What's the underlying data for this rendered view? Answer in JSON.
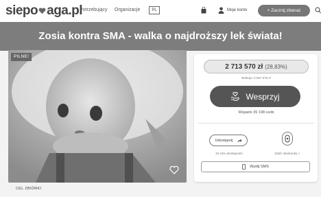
{
  "header": {
    "logo_left": "siepo",
    "logo_right": "aga.pl",
    "nav": [
      "Potrzebujący",
      "Organizacje"
    ],
    "language_flag": "PL",
    "account_label": "Moje konto",
    "start_button": "+ Zacznij zbierać",
    "icons": [
      "heart-icon",
      "bag-icon",
      "user-icon",
      "search-icon"
    ]
  },
  "banner": {
    "title": "Zosia kontra SMA - walka o najdroższy lek świata!"
  },
  "photo": {
    "urgent_badge": "PILNE!",
    "goal_label": "CEL ZBIÓRKI"
  },
  "panel": {
    "amount": "2 713 570 zł",
    "percent": "(28,83%)",
    "progress_fraction": 0.2883,
    "missing": "Brakuje: 6 697 678 zł",
    "support_button": "Wesprzyj",
    "supporters": "Wsparło 39 198 osób",
    "share_button": "Udostępnij",
    "shared_count": "33 416 udostępnień",
    "fundraiser_label": "Załóż skarbonkę >",
    "sms_button": "Wyślij SMS"
  },
  "colors": {
    "header_bg": "#ffffff",
    "banner_bg": "#7d7d7d",
    "button_dark": "#555555",
    "page_bg": "#f3f3f3"
  }
}
